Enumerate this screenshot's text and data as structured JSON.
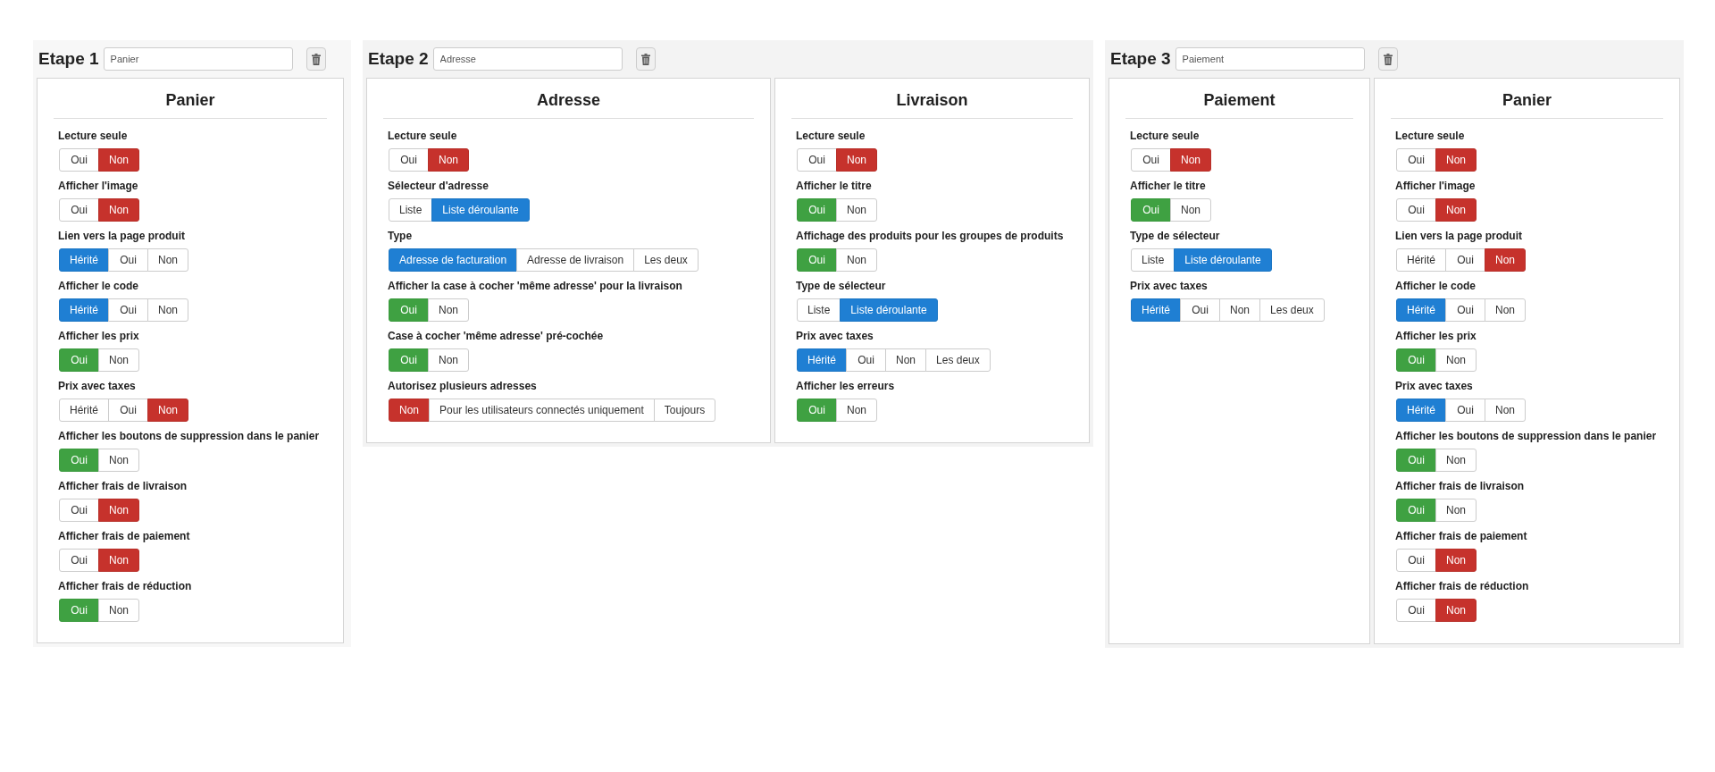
{
  "steps": [
    {
      "label": "Etape 1",
      "name_value": "Panier",
      "panels": [
        {
          "title": "Panier",
          "settings": [
            {
              "label": "Lecture seule",
              "options": [
                {
                  "text": "Oui",
                  "selected": false
                },
                {
                  "text": "Non",
                  "kind": "negative",
                  "selected": true
                }
              ]
            },
            {
              "label": "Afficher l'image",
              "options": [
                {
                  "text": "Oui",
                  "selected": false
                },
                {
                  "text": "Non",
                  "kind": "negative",
                  "selected": true
                }
              ]
            },
            {
              "label": "Lien vers la page produit",
              "options": [
                {
                  "text": "Hérité",
                  "kind": "neutral",
                  "selected": true
                },
                {
                  "text": "Oui",
                  "selected": false
                },
                {
                  "text": "Non",
                  "selected": false
                }
              ]
            },
            {
              "label": "Afficher le code",
              "options": [
                {
                  "text": "Hérité",
                  "kind": "neutral",
                  "selected": true
                },
                {
                  "text": "Oui",
                  "selected": false
                },
                {
                  "text": "Non",
                  "selected": false
                }
              ]
            },
            {
              "label": "Afficher les prix",
              "options": [
                {
                  "text": "Oui",
                  "kind": "positive",
                  "selected": true
                },
                {
                  "text": "Non",
                  "selected": false
                }
              ]
            },
            {
              "label": "Prix avec taxes",
              "options": [
                {
                  "text": "Hérité",
                  "selected": false
                },
                {
                  "text": "Oui",
                  "selected": false
                },
                {
                  "text": "Non",
                  "kind": "negative",
                  "selected": true
                }
              ]
            },
            {
              "label": "Afficher les boutons de suppression dans le panier",
              "options": [
                {
                  "text": "Oui",
                  "kind": "positive",
                  "selected": true
                },
                {
                  "text": "Non",
                  "selected": false
                }
              ]
            },
            {
              "label": "Afficher frais de livraison",
              "options": [
                {
                  "text": "Oui",
                  "selected": false
                },
                {
                  "text": "Non",
                  "kind": "negative",
                  "selected": true
                }
              ]
            },
            {
              "label": "Afficher frais de paiement",
              "options": [
                {
                  "text": "Oui",
                  "selected": false
                },
                {
                  "text": "Non",
                  "kind": "negative",
                  "selected": true
                }
              ]
            },
            {
              "label": "Afficher frais de réduction",
              "options": [
                {
                  "text": "Oui",
                  "kind": "positive",
                  "selected": true
                },
                {
                  "text": "Non",
                  "selected": false
                }
              ]
            }
          ]
        }
      ]
    },
    {
      "label": "Etape 2",
      "name_value": "Adresse",
      "panels": [
        {
          "title": "Adresse",
          "settings": [
            {
              "label": "Lecture seule",
              "options": [
                {
                  "text": "Oui",
                  "selected": false
                },
                {
                  "text": "Non",
                  "kind": "negative",
                  "selected": true
                }
              ]
            },
            {
              "label": "Sélecteur d'adresse",
              "options": [
                {
                  "text": "Liste",
                  "selected": false
                },
                {
                  "text": "Liste déroulante",
                  "kind": "neutral",
                  "selected": true
                }
              ]
            },
            {
              "label": "Type",
              "options": [
                {
                  "text": "Adresse de facturation",
                  "kind": "neutral",
                  "selected": true
                },
                {
                  "text": "Adresse de livraison",
                  "selected": false
                },
                {
                  "text": "Les deux",
                  "selected": false
                }
              ]
            },
            {
              "label": "Afficher la case à cocher 'même adresse' pour la livraison",
              "options": [
                {
                  "text": "Oui",
                  "kind": "positive",
                  "selected": true
                },
                {
                  "text": "Non",
                  "selected": false
                }
              ]
            },
            {
              "label": "Case à cocher 'même adresse' pré-cochée",
              "options": [
                {
                  "text": "Oui",
                  "kind": "positive",
                  "selected": true
                },
                {
                  "text": "Non",
                  "selected": false
                }
              ]
            },
            {
              "label": "Autorisez plusieurs adresses",
              "options": [
                {
                  "text": "Non",
                  "kind": "negative",
                  "selected": true
                },
                {
                  "text": "Pour les utilisateurs connectés uniquement",
                  "selected": false
                },
                {
                  "text": "Toujours",
                  "selected": false
                }
              ]
            }
          ]
        },
        {
          "title": "Livraison",
          "settings": [
            {
              "label": "Lecture seule",
              "options": [
                {
                  "text": "Oui",
                  "selected": false
                },
                {
                  "text": "Non",
                  "kind": "negative",
                  "selected": true
                }
              ]
            },
            {
              "label": "Afficher le titre",
              "options": [
                {
                  "text": "Oui",
                  "kind": "positive",
                  "selected": true
                },
                {
                  "text": "Non",
                  "selected": false
                }
              ]
            },
            {
              "label": "Affichage des produits pour les groupes de produits",
              "options": [
                {
                  "text": "Oui",
                  "kind": "positive",
                  "selected": true
                },
                {
                  "text": "Non",
                  "selected": false
                }
              ]
            },
            {
              "label": "Type de sélecteur",
              "options": [
                {
                  "text": "Liste",
                  "selected": false
                },
                {
                  "text": "Liste déroulante",
                  "kind": "neutral",
                  "selected": true
                }
              ]
            },
            {
              "label": "Prix avec taxes",
              "options": [
                {
                  "text": "Hérité",
                  "kind": "neutral",
                  "selected": true
                },
                {
                  "text": "Oui",
                  "selected": false
                },
                {
                  "text": "Non",
                  "selected": false
                },
                {
                  "text": "Les deux",
                  "selected": false
                }
              ]
            },
            {
              "label": "Afficher les erreurs",
              "options": [
                {
                  "text": "Oui",
                  "kind": "positive",
                  "selected": true
                },
                {
                  "text": "Non",
                  "selected": false
                }
              ]
            }
          ]
        }
      ]
    },
    {
      "label": "Etape 3",
      "name_value": "Paiement",
      "panels": [
        {
          "title": "Paiement",
          "settings": [
            {
              "label": "Lecture seule",
              "options": [
                {
                  "text": "Oui",
                  "selected": false
                },
                {
                  "text": "Non",
                  "kind": "negative",
                  "selected": true
                }
              ]
            },
            {
              "label": "Afficher le titre",
              "options": [
                {
                  "text": "Oui",
                  "kind": "positive",
                  "selected": true
                },
                {
                  "text": "Non",
                  "selected": false
                }
              ]
            },
            {
              "label": "Type de sélecteur",
              "options": [
                {
                  "text": "Liste",
                  "selected": false
                },
                {
                  "text": "Liste déroulante",
                  "kind": "neutral",
                  "selected": true
                }
              ]
            },
            {
              "label": "Prix avec taxes",
              "options": [
                {
                  "text": "Hérité",
                  "kind": "neutral",
                  "selected": true
                },
                {
                  "text": "Oui",
                  "selected": false
                },
                {
                  "text": "Non",
                  "selected": false
                },
                {
                  "text": "Les deux",
                  "selected": false
                }
              ]
            }
          ]
        },
        {
          "title": "Panier",
          "settings": [
            {
              "label": "Lecture seule",
              "options": [
                {
                  "text": "Oui",
                  "selected": false
                },
                {
                  "text": "Non",
                  "kind": "negative",
                  "selected": true
                }
              ]
            },
            {
              "label": "Afficher l'image",
              "options": [
                {
                  "text": "Oui",
                  "selected": false
                },
                {
                  "text": "Non",
                  "kind": "negative",
                  "selected": true
                }
              ]
            },
            {
              "label": "Lien vers la page produit",
              "options": [
                {
                  "text": "Hérité",
                  "selected": false
                },
                {
                  "text": "Oui",
                  "selected": false
                },
                {
                  "text": "Non",
                  "kind": "negative",
                  "selected": true
                }
              ]
            },
            {
              "label": "Afficher le code",
              "options": [
                {
                  "text": "Hérité",
                  "kind": "neutral",
                  "selected": true
                },
                {
                  "text": "Oui",
                  "selected": false
                },
                {
                  "text": "Non",
                  "selected": false
                }
              ]
            },
            {
              "label": "Afficher les prix",
              "options": [
                {
                  "text": "Oui",
                  "kind": "positive",
                  "selected": true
                },
                {
                  "text": "Non",
                  "selected": false
                }
              ]
            },
            {
              "label": "Prix avec taxes",
              "options": [
                {
                  "text": "Hérité",
                  "kind": "neutral",
                  "selected": true
                },
                {
                  "text": "Oui",
                  "selected": false
                },
                {
                  "text": "Non",
                  "selected": false
                }
              ]
            },
            {
              "label": "Afficher les boutons de suppression dans le panier",
              "options": [
                {
                  "text": "Oui",
                  "kind": "positive",
                  "selected": true
                },
                {
                  "text": "Non",
                  "selected": false
                }
              ]
            },
            {
              "label": "Afficher frais de livraison",
              "options": [
                {
                  "text": "Oui",
                  "kind": "positive",
                  "selected": true
                },
                {
                  "text": "Non",
                  "selected": false
                }
              ]
            },
            {
              "label": "Afficher frais de paiement",
              "options": [
                {
                  "text": "Oui",
                  "selected": false
                },
                {
                  "text": "Non",
                  "kind": "negative",
                  "selected": true
                }
              ]
            },
            {
              "label": "Afficher frais de réduction",
              "options": [
                {
                  "text": "Oui",
                  "selected": false
                },
                {
                  "text": "Non",
                  "kind": "negative",
                  "selected": true
                }
              ]
            }
          ]
        }
      ]
    }
  ]
}
